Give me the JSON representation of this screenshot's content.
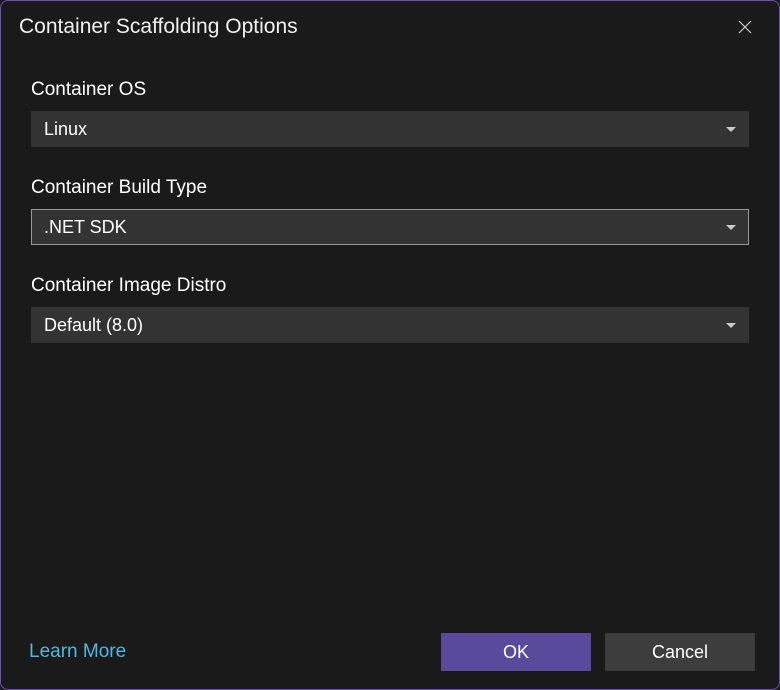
{
  "dialog": {
    "title": "Container Scaffolding Options"
  },
  "fields": {
    "containerOs": {
      "label": "Container OS",
      "value": "Linux"
    },
    "buildType": {
      "label": "Container Build Type",
      "value": ".NET SDK"
    },
    "imageDistro": {
      "label": "Container Image Distro",
      "value": "Default (8.0)"
    }
  },
  "footer": {
    "learnMore": "Learn More",
    "ok": "OK",
    "cancel": "Cancel"
  }
}
